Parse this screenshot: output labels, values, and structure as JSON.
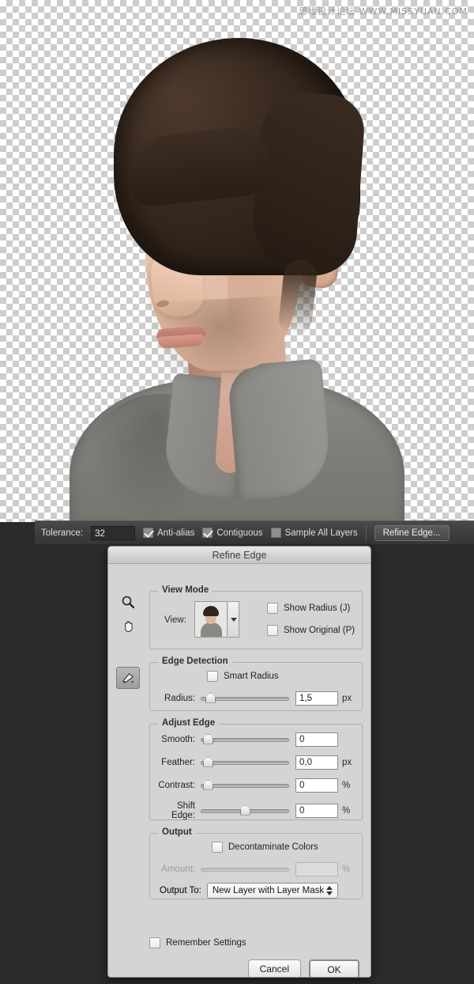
{
  "canvas": {
    "watermark": "思缘设计论坛 WWW.MISSYUAN.COM",
    "transparency_checker": "checkerboard",
    "subject": "man portrait cutout on transparent background"
  },
  "options_bar": {
    "tolerance_label": "Tolerance:",
    "tolerance_value": "32",
    "anti_alias_label": "Anti-alias",
    "anti_alias_checked": true,
    "contiguous_label": "Contiguous",
    "contiguous_checked": true,
    "sample_all_layers_label": "Sample All Layers",
    "sample_all_layers_checked": false,
    "refine_edge_button": "Refine Edge..."
  },
  "dialog": {
    "title": "Refine Edge",
    "tools": {
      "zoom_tool": "zoom-tool",
      "hand_tool": "hand-tool",
      "refine_radius_brush": "refine-radius-brush-tool"
    },
    "view_mode": {
      "title": "View Mode",
      "view_label": "View:",
      "show_radius_label": "Show Radius (J)",
      "show_radius_checked": false,
      "show_original_label": "Show Original (P)",
      "show_original_checked": false
    },
    "edge_detection": {
      "title": "Edge Detection",
      "smart_radius_label": "Smart Radius",
      "smart_radius_checked": false,
      "radius_label": "Radius:",
      "radius_value": "1,5",
      "radius_unit": "px",
      "radius_percent": 5
    },
    "adjust_edge": {
      "title": "Adjust Edge",
      "rows": [
        {
          "label": "Smooth:",
          "value": "0",
          "unit": "",
          "percent": 2
        },
        {
          "label": "Feather:",
          "value": "0,0",
          "unit": "px",
          "percent": 2
        },
        {
          "label": "Contrast:",
          "value": "0",
          "unit": "%",
          "percent": 2
        },
        {
          "label": "Shift Edge:",
          "value": "0",
          "unit": "%",
          "percent": 50
        }
      ]
    },
    "output": {
      "title": "Output",
      "decontaminate_label": "Decontaminate Colors",
      "decontaminate_checked": false,
      "amount_label": "Amount:",
      "amount_value": "",
      "amount_unit": "%",
      "amount_percent": 100,
      "amount_disabled": true,
      "output_to_label": "Output To:",
      "output_to_value": "New Layer with Layer Mask"
    },
    "footer": {
      "remember_settings_label": "Remember Settings",
      "remember_settings_checked": false,
      "cancel_label": "Cancel",
      "ok_label": "OK"
    }
  },
  "colors": {
    "dialog_bg": "#d4d4d4",
    "toolbar_bg": "#3d3d3d",
    "app_bg": "#2b2b2b",
    "checker_gray": "#cdcdcd"
  }
}
